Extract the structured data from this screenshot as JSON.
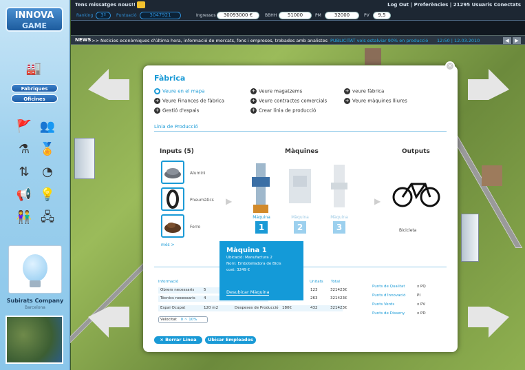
{
  "sidebar": {
    "logo_line1": "INNOVA",
    "logo_line2": "GAME",
    "menu_fabriques": "Fabriques",
    "menu_oficines": "Oficines",
    "company_name": "Subirats Company",
    "company_location": "Barcelona"
  },
  "topbar": {
    "messages": "Tens missatges nous!!  (6)",
    "links": "Log Out | Preferències | 21295 Usuaris Conectats",
    "ranking_label": "Ranking",
    "ranking_value": "3º",
    "puntuacio_label": "Puntuació",
    "puntuacio_value": "3047921",
    "ingressos_label": "Ingressos",
    "ingressos_value": "30093000 €",
    "bbhh_label": "BBHH",
    "bbhh_value": "51000",
    "pm_label": "PM",
    "pm_value": "32000",
    "pv_label": "PV",
    "pv_value": "9,5"
  },
  "news": {
    "label": "NEWS",
    "text": ">> Notícies econòmiques d'última hora, informació de mercats, fons i empreses, trobades amb analistes",
    "publicitat": "PUBLICITAT vols estalviar 90% en producció",
    "datetime": "12:50 | 12.03.2010"
  },
  "dialog": {
    "title": "Fàbrica",
    "links": [
      {
        "label": "Veure en el mapa",
        "active": true
      },
      {
        "label": "Veure Finances de fàbrica"
      },
      {
        "label": "Gestió d'espais"
      },
      {
        "label": "Veure magatzems"
      },
      {
        "label": "Veure contractes comercials"
      },
      {
        "label": "Crear línia de producció"
      },
      {
        "label": "veure fàbrica"
      },
      {
        "label": "Veure màquines lliures"
      }
    ],
    "section": "Línia de Producció",
    "inputs_header": "Inputs (5)",
    "machines_header": "Màquines",
    "outputs_header": "Outputs",
    "inputs": [
      {
        "name": "Alumini"
      },
      {
        "name": "Pneumàtics"
      },
      {
        "name": "Ferro"
      }
    ],
    "mes": "més >",
    "machines": [
      {
        "label": "Màquina",
        "num": "1",
        "active": true
      },
      {
        "label": "Màquina",
        "num": "2"
      },
      {
        "label": "Màquina",
        "num": "3"
      }
    ],
    "output": "Bicicleta",
    "info": {
      "head": "Informació",
      "col_unitats": "Unitats",
      "col_total": "Total",
      "rows": [
        {
          "label": "Obrers necessaris",
          "val": "5"
        },
        {
          "label": "Tècnics necessaris",
          "val": "4"
        },
        {
          "label": "Espai Ocupat",
          "val": "120 m2"
        }
      ],
      "despeses_label": "Despeses de Producció",
      "despeses_val": "180€",
      "unitats": [
        "123",
        "263",
        "432"
      ],
      "totals": [
        "321423€",
        "321423€",
        "321423€"
      ]
    },
    "velocitat": "Velocitat",
    "velocitat_val": "0 ~ 10%",
    "points": [
      {
        "label": "Punts de Qualitat",
        "val": "x PQ"
      },
      {
        "label": "Punts d'Innovació",
        "val": "PI"
      },
      {
        "label": "Punts Verds",
        "val": "x PV"
      },
      {
        "label": "Punts de Disseny",
        "val": "x PD"
      }
    ],
    "btn_borrar": "Borrar Línea",
    "btn_ubicar": "Ubicar Empleados"
  },
  "popup": {
    "title": "Màquina 1",
    "ubicacio": "Ubicació: Manufactura 2",
    "nom": "Nom: Embotelladora de Bicis",
    "cost": "cost: 3249 €",
    "button": "Desubicar Màquina"
  },
  "colors": {
    "accent": "#1a9ad6",
    "sidebar": "#9fd1ee"
  }
}
